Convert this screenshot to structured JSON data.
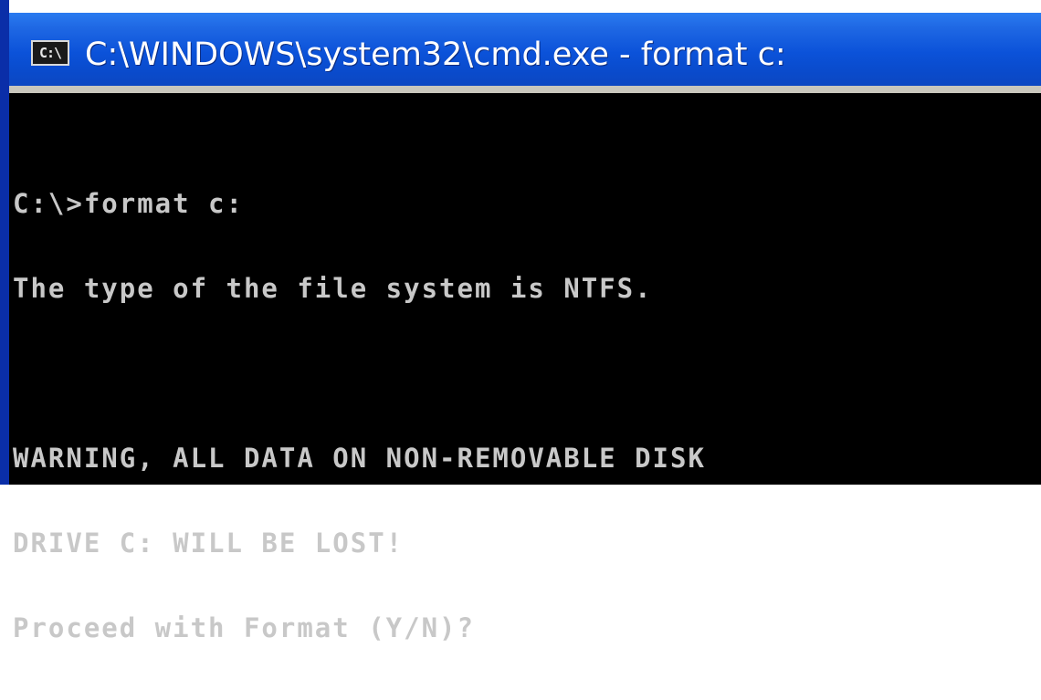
{
  "window": {
    "title": "C:\\WINDOWS\\system32\\cmd.exe - format c:",
    "icon_label": "C:\\",
    "icon": "console-icon"
  },
  "console": {
    "lines": [
      "C:\\>format c:",
      "The type of the file system is NTFS.",
      "",
      "WARNING, ALL DATA ON NON-REMOVABLE DISK",
      "DRIVE C: WILL BE LOST!",
      "Proceed with Format (Y/N)?"
    ]
  },
  "colors": {
    "titlebar": "#0b52d9",
    "console_background": "#000000",
    "console_text": "#c8c8c8"
  }
}
